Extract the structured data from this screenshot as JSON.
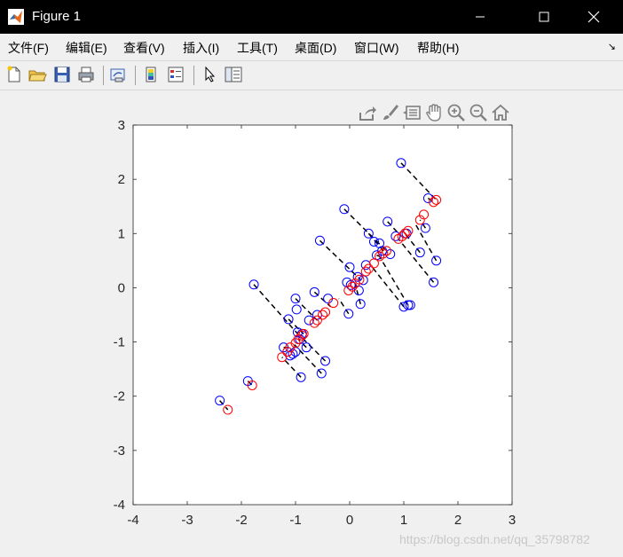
{
  "window": {
    "title": "Figure 1",
    "buttons": {
      "minimize": "minimize",
      "maximize": "maximize",
      "close": "close"
    }
  },
  "menu": {
    "items": [
      {
        "label": "文件(F)"
      },
      {
        "label": "编辑(E)"
      },
      {
        "label": "查看(V)"
      },
      {
        "label": "插入(I)"
      },
      {
        "label": "工具(T)"
      },
      {
        "label": "桌面(D)"
      },
      {
        "label": "窗口(W)"
      },
      {
        "label": "帮助(H)"
      }
    ],
    "dock_icon": "↘"
  },
  "toolbar": {
    "icons": [
      "new-figure-icon",
      "open-file-icon",
      "save-icon",
      "print-icon",
      "link-plot-icon",
      "colorbar-icon",
      "legend-icon",
      "edit-plot-arrow-icon",
      "property-inspector-icon"
    ]
  },
  "axes_toolbar": {
    "icons": [
      "export-icon",
      "brush-icon",
      "data-tips-icon",
      "pan-hand-icon",
      "zoom-in-icon",
      "zoom-out-icon",
      "home-icon"
    ]
  },
  "watermark": "https://blog.csdn.net/qq_35798782",
  "colors": {
    "original": "#0000ff",
    "projected": "#ff0000",
    "lines": "#000000"
  },
  "chart_data": {
    "type": "scatter",
    "xlim": [
      -4,
      3
    ],
    "ylim": [
      -4,
      3
    ],
    "xticks": [
      "-4",
      "-3",
      "-2",
      "-1",
      "0",
      "1",
      "2",
      "3"
    ],
    "yticks": [
      "-4",
      "-3",
      "-2",
      "-1",
      "0",
      "1",
      "2",
      "3"
    ],
    "grid": false,
    "series": [
      {
        "marker": "circle",
        "color": "#0000ff",
        "points": [
          [
            -2.4,
            -2.08
          ],
          [
            -1.88,
            -1.72
          ],
          [
            -1.77,
            0.06
          ],
          [
            -1.22,
            -1.1
          ],
          [
            -1.15,
            -1.18
          ],
          [
            -1.1,
            -1.25
          ],
          [
            -1.13,
            -0.58
          ],
          [
            -1.05,
            -1.22
          ],
          [
            -1.0,
            -1.18
          ],
          [
            -1.0,
            -0.2
          ],
          [
            -0.98,
            -0.4
          ],
          [
            -0.96,
            -0.82
          ],
          [
            -0.92,
            -0.95
          ],
          [
            -0.9,
            -1.65
          ],
          [
            -0.88,
            -0.85
          ],
          [
            -0.8,
            -1.1
          ],
          [
            -0.75,
            -0.6
          ],
          [
            -0.65,
            -0.08
          ],
          [
            -0.6,
            -0.5
          ],
          [
            -0.55,
            0.87
          ],
          [
            -0.52,
            -1.58
          ],
          [
            -0.45,
            -1.35
          ],
          [
            -0.4,
            -0.2
          ],
          [
            -0.1,
            1.45
          ],
          [
            -0.05,
            0.1
          ],
          [
            -0.02,
            -0.48
          ],
          [
            0.0,
            0.38
          ],
          [
            0.02,
            0.05
          ],
          [
            0.15,
            0.2
          ],
          [
            0.17,
            -0.05
          ],
          [
            0.2,
            -0.3
          ],
          [
            0.25,
            0.14
          ],
          [
            0.3,
            0.42
          ],
          [
            0.35,
            1.0
          ],
          [
            0.45,
            0.85
          ],
          [
            0.5,
            0.6
          ],
          [
            0.55,
            0.82
          ],
          [
            0.6,
            0.68
          ],
          [
            0.7,
            1.22
          ],
          [
            0.75,
            0.62
          ],
          [
            0.85,
            0.95
          ],
          [
            0.95,
            2.3
          ],
          [
            1.0,
            -0.35
          ],
          [
            1.05,
            1.0
          ],
          [
            1.08,
            -0.32
          ],
          [
            1.12,
            -0.32
          ],
          [
            1.3,
            0.65
          ],
          [
            1.4,
            1.1
          ],
          [
            1.45,
            1.65
          ],
          [
            1.55,
            0.1
          ],
          [
            1.6,
            0.5
          ]
        ]
      },
      {
        "marker": "circle",
        "color": "#ff0000",
        "points": [
          [
            -2.25,
            -2.25
          ],
          [
            -1.8,
            -1.8
          ],
          [
            -1.25,
            -1.28
          ],
          [
            -1.15,
            -1.18
          ],
          [
            -1.1,
            -1.1
          ],
          [
            -1.0,
            -1.02
          ],
          [
            -0.95,
            -0.95
          ],
          [
            -0.88,
            -0.88
          ],
          [
            -0.85,
            -0.85
          ],
          [
            -0.65,
            -0.65
          ],
          [
            -0.6,
            -0.6
          ],
          [
            -0.5,
            -0.5
          ],
          [
            -0.45,
            -0.45
          ],
          [
            -0.3,
            -0.28
          ],
          [
            -0.02,
            -0.05
          ],
          [
            0.05,
            0.02
          ],
          [
            0.1,
            0.08
          ],
          [
            0.18,
            0.15
          ],
          [
            0.3,
            0.3
          ],
          [
            0.35,
            0.35
          ],
          [
            0.45,
            0.45
          ],
          [
            0.55,
            0.58
          ],
          [
            0.62,
            0.63
          ],
          [
            0.68,
            0.68
          ],
          [
            0.9,
            0.9
          ],
          [
            0.97,
            0.95
          ],
          [
            1.02,
            1.0
          ],
          [
            1.08,
            1.05
          ],
          [
            1.3,
            1.25
          ],
          [
            1.37,
            1.35
          ],
          [
            1.55,
            1.58
          ],
          [
            1.6,
            1.62
          ]
        ]
      }
    ],
    "segments": [
      [
        [
          -2.4,
          -2.08
        ],
        [
          -2.25,
          -2.25
        ]
      ],
      [
        [
          -1.88,
          -1.72
        ],
        [
          -1.8,
          -1.8
        ]
      ],
      [
        [
          -1.77,
          0.06
        ],
        [
          -0.96,
          -0.85
        ]
      ],
      [
        [
          -1.13,
          -0.58
        ],
        [
          -0.85,
          -0.85
        ]
      ],
      [
        [
          -1.0,
          -0.2
        ],
        [
          -0.6,
          -0.6
        ]
      ],
      [
        [
          -0.65,
          -0.08
        ],
        [
          -0.35,
          -0.35
        ]
      ],
      [
        [
          -0.55,
          0.87
        ],
        [
          0.2,
          0.15
        ]
      ],
      [
        [
          -0.1,
          1.45
        ],
        [
          0.68,
          0.68
        ]
      ],
      [
        [
          0.35,
          1.0
        ],
        [
          0.65,
          0.65
        ]
      ],
      [
        [
          0.7,
          1.22
        ],
        [
          0.95,
          0.95
        ]
      ],
      [
        [
          0.95,
          2.3
        ],
        [
          1.6,
          1.62
        ]
      ],
      [
        [
          1.3,
          0.65
        ],
        [
          1.02,
          1.0
        ]
      ],
      [
        [
          1.55,
          0.1
        ],
        [
          0.9,
          0.9
        ]
      ],
      [
        [
          1.6,
          0.5
        ],
        [
          1.2,
          1.2
        ]
      ],
      [
        [
          1.08,
          -0.32
        ],
        [
          0.55,
          0.58
        ]
      ],
      [
        [
          1.0,
          -0.35
        ],
        [
          0.4,
          0.4
        ]
      ],
      [
        [
          0.2,
          -0.3
        ],
        [
          0.1,
          0.08
        ]
      ],
      [
        [
          -0.02,
          -0.48
        ],
        [
          -0.2,
          -0.2
        ]
      ],
      [
        [
          -0.45,
          -1.35
        ],
        [
          -0.9,
          -0.9
        ]
      ],
      [
        [
          -0.52,
          -1.58
        ],
        [
          -1.02,
          -1.05
        ]
      ],
      [
        [
          -0.9,
          -1.65
        ],
        [
          -1.25,
          -1.28
        ]
      ],
      [
        [
          -0.8,
          -1.1
        ],
        [
          -0.95,
          -0.95
        ]
      ],
      [
        [
          -1.22,
          -1.1
        ],
        [
          -1.1,
          -1.1
        ]
      ],
      [
        [
          1.4,
          1.1
        ],
        [
          1.3,
          1.25
        ]
      ],
      [
        [
          1.45,
          1.65
        ],
        [
          1.55,
          1.58
        ]
      ],
      [
        [
          0.5,
          0.6
        ],
        [
          0.55,
          0.58
        ]
      ]
    ]
  }
}
